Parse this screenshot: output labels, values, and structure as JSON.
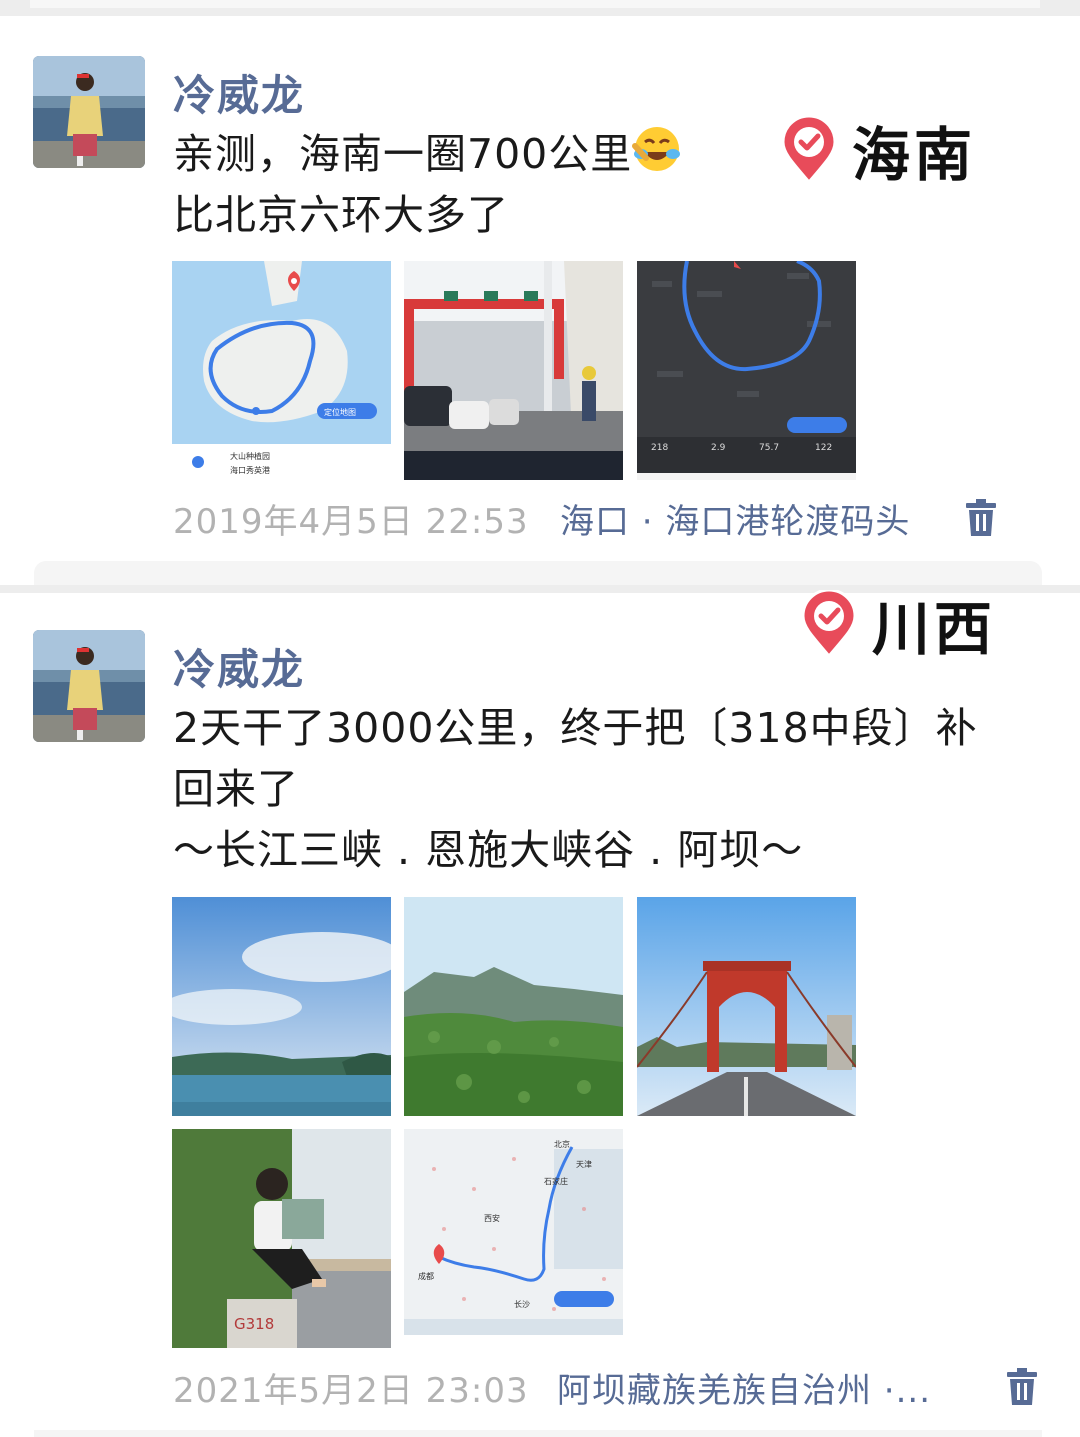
{
  "posts": [
    {
      "author": "冷威龙",
      "text_line1": "亲测，海南一圈700公里",
      "text_line2": "比北京六环大多了",
      "emoji": "laughing-crying-emoji",
      "sticker_label": "海南",
      "photos": [
        {
          "name": "hainan-route-map",
          "labels": [
            "大山种植园",
            "海口秀英港",
            "定位地图"
          ]
        },
        {
          "name": "ferry-photo"
        },
        {
          "name": "city-route-map",
          "labels": [
            "218",
            "2.9",
            "75.7",
            "122"
          ]
        }
      ],
      "time": "2019年4月5日 22:53",
      "location": "海口 · 海口港轮渡码头"
    },
    {
      "author": "冷威龙",
      "text_line1": "2天干了3000公里，终于把〔318中段〕补",
      "text_line2": "回来了",
      "text_line3": "～长江三峡 . 恩施大峡谷 . 阿坝～",
      "sticker_label": "川西",
      "photos": [
        {
          "name": "river-gorge-photo"
        },
        {
          "name": "mountain-valley-photo"
        },
        {
          "name": "red-bridge-photo"
        },
        {
          "name": "g318-marker-photo",
          "labels": [
            "G318"
          ]
        },
        {
          "name": "china-route-map",
          "labels": [
            "北京",
            "天津",
            "石家庄",
            "西安",
            "长沙",
            "成都"
          ]
        }
      ],
      "time": "2021年5月2日 23:03",
      "location": "阿坝藏族羌族自治州 ·..."
    }
  ],
  "icons": {
    "trash": "trash-icon",
    "pin": "checkmark-pin-icon"
  },
  "colors": {
    "name": "#576b95",
    "meta": "#b2b2b2",
    "pin": "#e84b5a"
  }
}
